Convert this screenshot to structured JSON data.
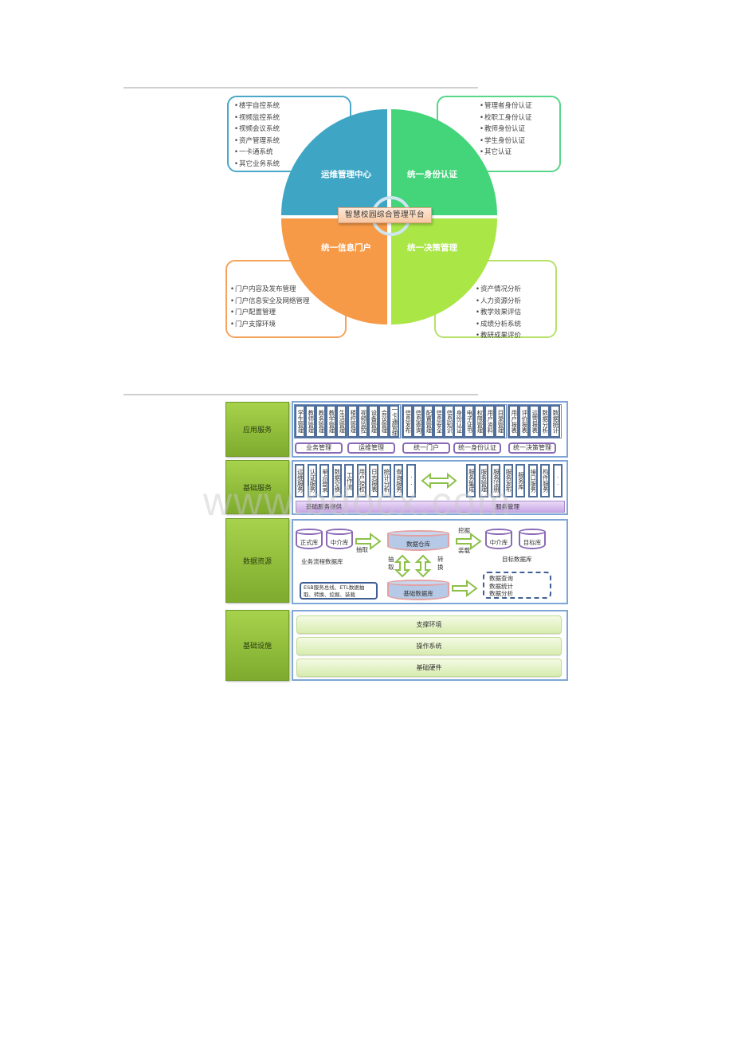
{
  "top_diagram": {
    "center_label": "智慧校园综合管理平台",
    "quadrants": [
      {
        "id": "tl",
        "title": "运维管理中心",
        "color": "#3ea6c4",
        "items": [
          "楼宇自控系统",
          "视频监控系统",
          "视频会议系统",
          "资产管理系统",
          "一卡通系统",
          "其它业务系统"
        ]
      },
      {
        "id": "tr",
        "title": "统一身份认证",
        "color": "#44d47a",
        "items": [
          "管理者身份认证",
          "校职工身份认证",
          "教师身份认证",
          "学生身份认证",
          "其它认证"
        ]
      },
      {
        "id": "bl",
        "title": "统一信息门户",
        "color": "#f79a47",
        "items": [
          "门户内容及发布管理",
          "门户信息安全及网络管理",
          "门户配置管理",
          "门户支撑环境"
        ]
      },
      {
        "id": "br",
        "title": "统一决策管理",
        "color": "#a9e646",
        "items": [
          "资产情况分析",
          "人力资源分析",
          "教学效果评估",
          "成绩分析系统",
          "教研成果评价"
        ]
      }
    ]
  },
  "architecture": {
    "layers": [
      {
        "label": "应用服务",
        "groups": [
          {
            "label": "业务管理",
            "items": [
              "学生管理",
              "教师管理",
              "教务管理",
              "教学管理",
              "生活管理"
            ]
          },
          {
            "label": "运维管理",
            "items": [
              "楼控管理",
              "视频监控",
              "设备管理",
              "会议管理",
              "一卡通管理"
            ]
          },
          {
            "label": "统一门户",
            "items": [
              "信息发布",
              "信息查询",
              "配置管理",
              "信息安全",
              "信息知识"
            ]
          },
          {
            "label": "统一身份认证",
            "items": [
              "身份认证",
              "电子证书",
              "权限管理",
              "用户资料",
              "目录管理"
            ]
          },
          {
            "label": "统一决策管理",
            "items": [
              "用户报表",
              "评价报表",
              "运营报表",
              "数据分析",
              "数据统计"
            ]
          }
        ]
      },
      {
        "label": "基础服务",
        "left_items": [
          "运维服务",
          "认证服务",
          "单点登录",
          "数据交换",
          "工作流",
          "用户授权",
          "日志报表",
          "统计分析",
          "查询服务",
          "··"
        ],
        "right_items": [
          "服务集成",
          "服务管理",
          "服务注册",
          "服务发布",
          "服务库",
          "接口服务",
          "构件服务",
          "··"
        ],
        "left_bar": "基础服务提供",
        "right_bar": "服务管理"
      },
      {
        "label": "数据资源",
        "business_db": {
          "label": "业务流程数据库",
          "items": [
            "正式库",
            "中介库"
          ]
        },
        "extract_label": "抽取",
        "warehouse": "数据仓库",
        "base_db": "基础数据库",
        "left_arrow_label": "抽取",
        "right_arrow_label": "转换",
        "mine_load_labels": [
          "挖掘",
          "装载"
        ],
        "target_db": {
          "label": "目标数据库",
          "items": [
            "中介库",
            "目标库"
          ]
        },
        "esb_text": "ESB服务总线、ETL数据抽取、转换、挖掘、装载",
        "outputs": [
          "数据查询",
          "数据统计",
          "数据分析"
        ]
      },
      {
        "label": "基础设施",
        "items": [
          "支撑环境",
          "操作系统",
          "基础硬件"
        ]
      }
    ]
  },
  "watermark": "www.bdocx.com"
}
